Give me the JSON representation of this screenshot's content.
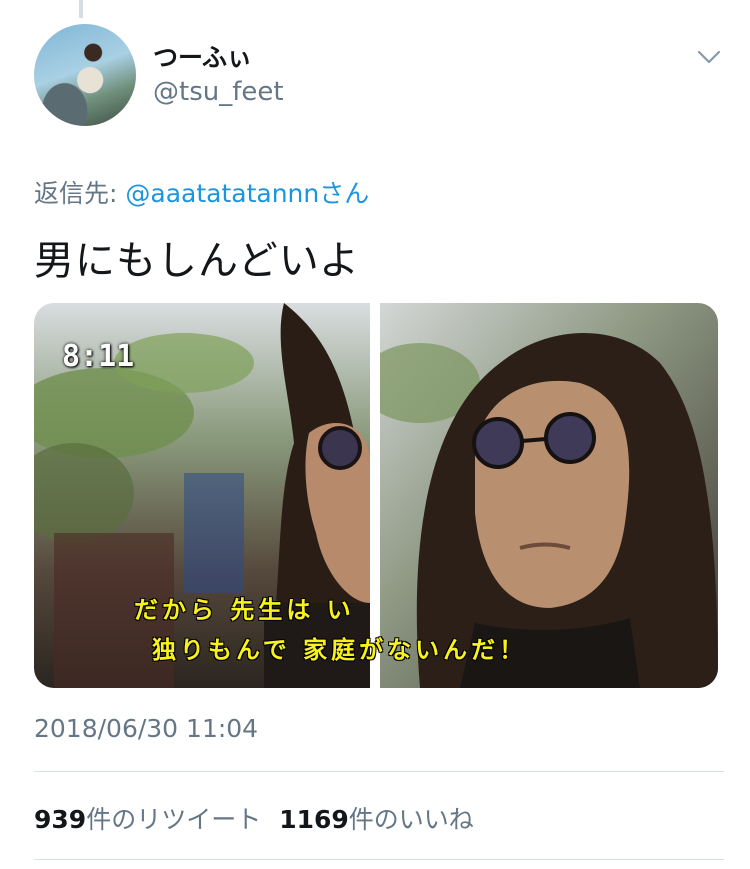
{
  "user": {
    "display_name": "つーふぃ",
    "handle": "@tsu_feet"
  },
  "reply": {
    "prefix": "返信先: ",
    "mention": "@aaatatatannnさん"
  },
  "tweet": {
    "text": "男にもしんどいよ",
    "media": {
      "clock": "8:11",
      "subtitle_line1": "だから 先生は い",
      "subtitle_line2": "独りもんで 家庭がないんだ！"
    },
    "timestamp": "2018/06/30 11:04"
  },
  "stats": {
    "retweets_count": "939",
    "retweets_label": "件のリツイート",
    "likes_count": "1169",
    "likes_label": "件のいいね"
  },
  "colors": {
    "link": "#1b95e0",
    "secondary_text": "#657786",
    "primary_text": "#14171a"
  }
}
